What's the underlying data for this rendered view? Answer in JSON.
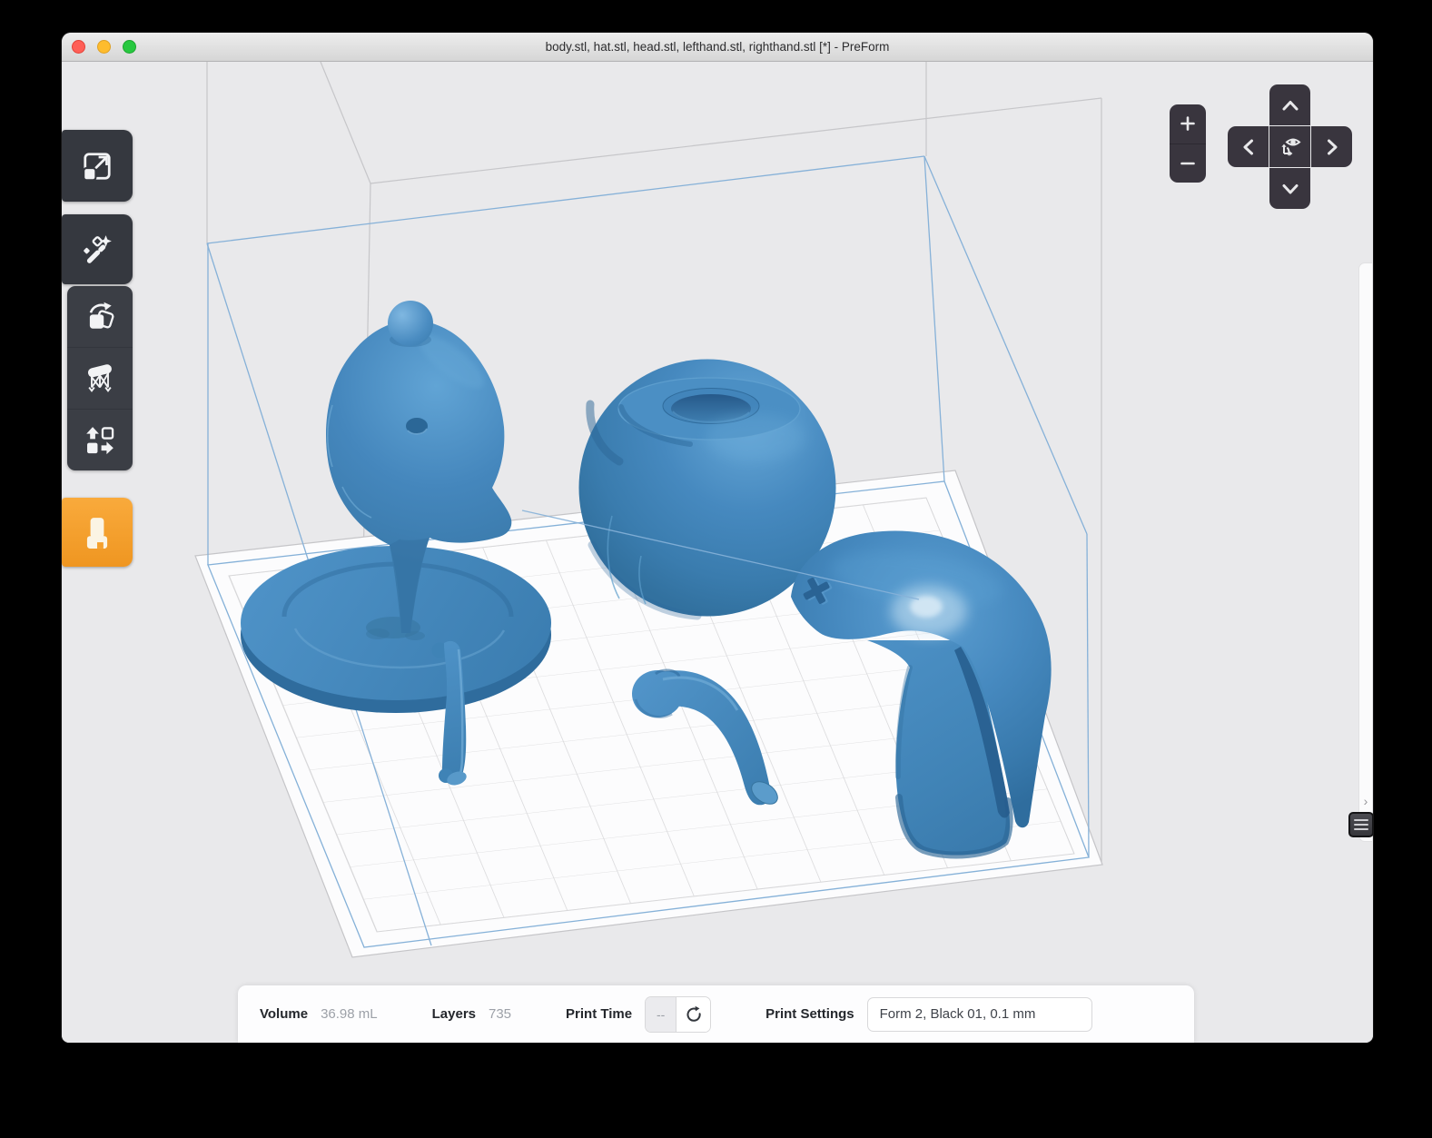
{
  "window": {
    "title": "body.stl, hat.stl, head.stl, lefthand.stl, righthand.stl [*] - PreForm"
  },
  "sidebar": {
    "accent_color": "#F5A02C",
    "tools": [
      {
        "id": "size",
        "icon": "scale-icon"
      },
      {
        "id": "one-click-print",
        "icon": "magic-wand-icon"
      },
      {
        "id": "orientation",
        "icon": "rotate-icon"
      },
      {
        "id": "supports",
        "icon": "supports-icon"
      },
      {
        "id": "layout",
        "icon": "layout-icon"
      },
      {
        "id": "print-setup",
        "icon": "cartridge-icon",
        "highlighted": true
      }
    ]
  },
  "viewport": {
    "models": [
      "hat",
      "head",
      "body",
      "lefthand",
      "righthand"
    ],
    "model_color": "#4285BB",
    "build_volume_color": "#86B1D8",
    "outer_frame_color": "#C6C6C9"
  },
  "nav": {
    "zoom_in": "+",
    "zoom_out": "−"
  },
  "drawer": {
    "chevron": "›"
  },
  "status_bar": {
    "volume_label": "Volume",
    "volume_value": "36.98 mL",
    "layers_label": "Layers",
    "layers_value": "735",
    "print_time_label": "Print Time",
    "print_time_value": "--",
    "print_settings_label": "Print Settings",
    "print_settings_value": "Form 2, Black 01, 0.1 mm"
  }
}
